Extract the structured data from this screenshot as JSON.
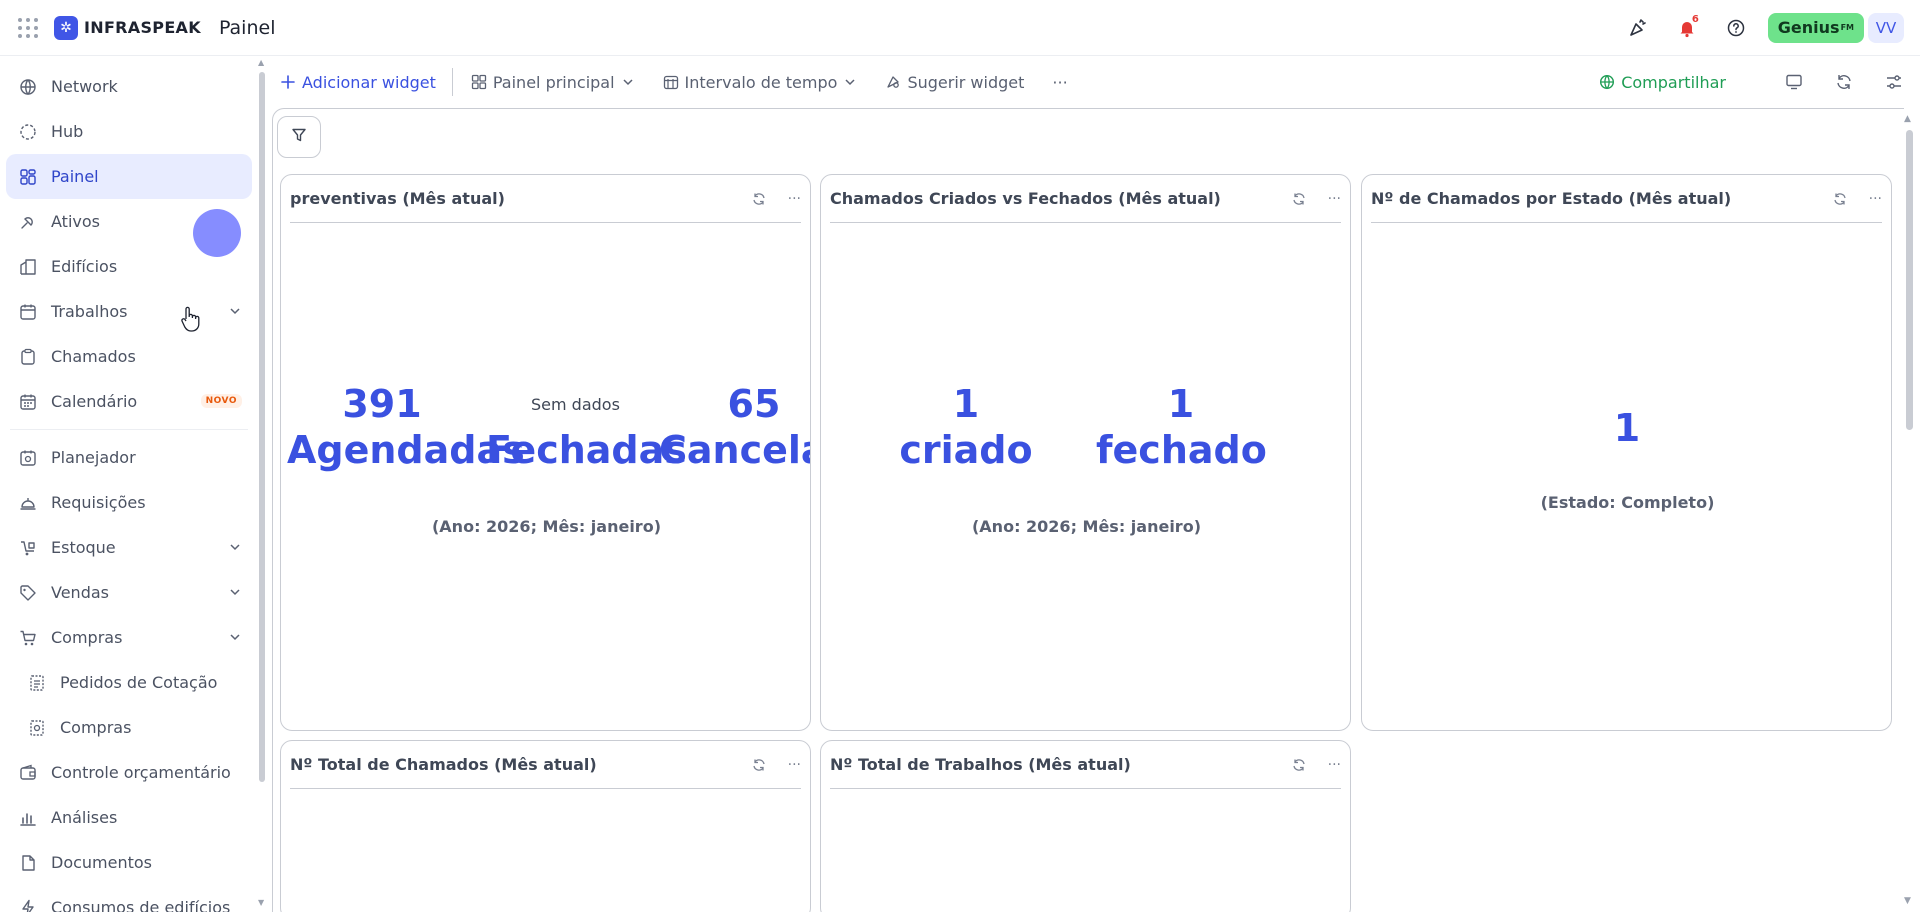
{
  "topbar": {
    "logo_text": "INFRASPEAK",
    "page_title": "Painel",
    "notification_count": "6",
    "genius_label": "Genius",
    "genius_sup": "FM",
    "avatar_initials": "VV"
  },
  "sidebar": {
    "items": [
      {
        "label": "Network",
        "icon": "globe-icon"
      },
      {
        "label": "Hub",
        "icon": "hub-icon"
      },
      {
        "label": "Painel",
        "icon": "dashboard-icon"
      },
      {
        "label": "Ativos",
        "icon": "assets-icon"
      },
      {
        "label": "Edifícios",
        "icon": "building-icon"
      },
      {
        "label": "Trabalhos",
        "icon": "calendar-jobs-icon"
      },
      {
        "label": "Chamados",
        "icon": "clipboard-icon"
      },
      {
        "label": "Calendário",
        "icon": "calendar-icon",
        "badge": "NOVO"
      },
      {
        "label": "Planejador",
        "icon": "planner-icon"
      },
      {
        "label": "Requisições",
        "icon": "bell-service-icon"
      },
      {
        "label": "Estoque",
        "icon": "stock-icon"
      },
      {
        "label": "Vendas",
        "icon": "tag-icon"
      },
      {
        "label": "Compras",
        "icon": "cart-icon"
      },
      {
        "label": "Pedidos de Cotação",
        "icon": "quote-icon"
      },
      {
        "label": "Compras",
        "icon": "purchases-icon"
      },
      {
        "label": "Controle orçamentário",
        "icon": "wallet-icon"
      },
      {
        "label": "Análises",
        "icon": "bar-chart-icon"
      },
      {
        "label": "Documentos",
        "icon": "document-icon"
      },
      {
        "label": "Consumos de edifícios",
        "icon": "bolt-icon"
      }
    ]
  },
  "toolbar": {
    "add_widget": "Adicionar widget",
    "main_panel": "Painel principal",
    "time_interval": "Intervalo de tempo",
    "suggest_widget": "Sugerir widget",
    "more": "···",
    "share": "Compartilhar"
  },
  "widgets": {
    "w1": {
      "title": "preventivas (Mês atual)",
      "value_a": "391",
      "label_a": "Agendadas",
      "no_data": "Sem dados",
      "label_b": "Fechadas",
      "value_c": "65",
      "label_c": "Cancelad",
      "period": "(Ano: 2026; Mês: janeiro)"
    },
    "w2": {
      "title": "Chamados Criados vs Fechados (Mês atual)",
      "value_a": "1",
      "label_a": "criado",
      "value_b": "1",
      "label_b": "fechado",
      "period": "(Ano: 2026; Mês: janeiro)"
    },
    "w3": {
      "title": "Nº de Chamados por Estado (Mês atual)",
      "value": "1",
      "state": "(Estado: Completo)"
    },
    "w4": {
      "title": "Nº Total de Chamados (Mês atual)"
    },
    "w5": {
      "title": "Nº Total de Trabalhos (Mês atual)"
    }
  },
  "colors": {
    "accent": "#3a51e0",
    "share": "#1f9d55",
    "genius": "#6ee28b",
    "active_bg": "#e8ecff"
  }
}
